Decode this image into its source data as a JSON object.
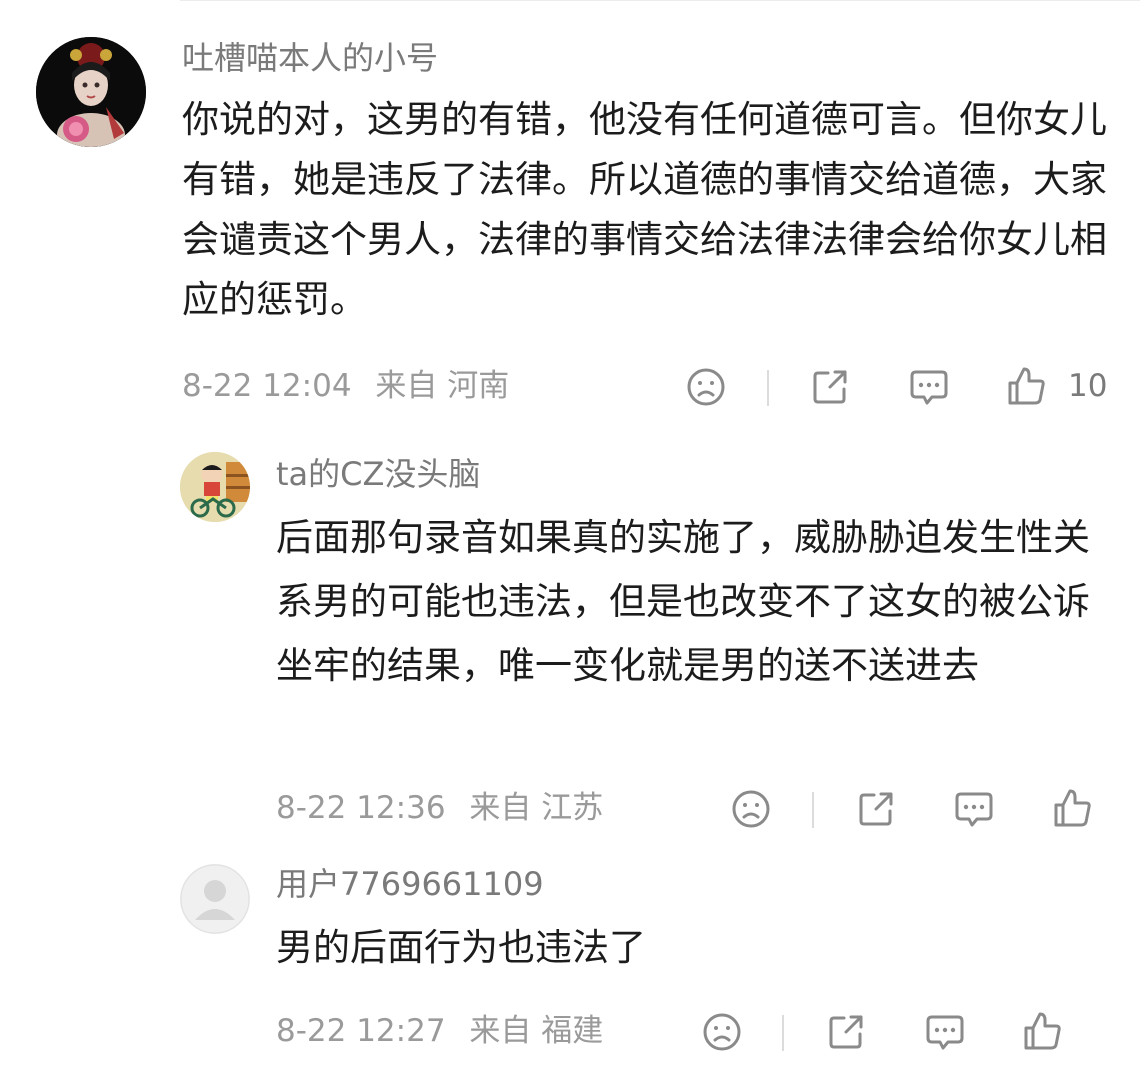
{
  "comments": [
    {
      "user": "吐槽喵本人的小号",
      "text": "你说的对，这男的有错，他没有任何道德可言。但你女儿有错，她是违反了法律。所以道德的事情交给道德，大家会谴责这个男人，法律的事情交给法律法律会给你女儿相应的惩罚。",
      "date": "8-22 12:04",
      "location": "来自 河南",
      "likes": "10"
    },
    {
      "user": "ta的CZ没头脑",
      "text": "后面那句录音如果真的实施了，威胁胁迫发生性关系男的可能也违法，但是也改变不了这女的被公诉坐牢的结果，唯一变化就是男的送不送进去",
      "date": "8-22 12:36",
      "location": "来自 江苏"
    },
    {
      "user": "用户7769661109",
      "text": "男的后面行为也违法了",
      "date": "8-22 12:27",
      "location": "来自 福建"
    }
  ],
  "icons": {
    "dislike": "sad-face-icon",
    "share": "share-icon",
    "comment": "chat-bubble-icon",
    "like": "thumbs-up-icon"
  }
}
